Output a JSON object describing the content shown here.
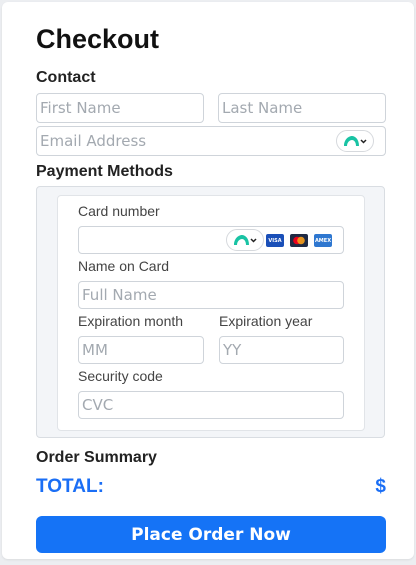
{
  "checkout": {
    "title": "Checkout",
    "contact": {
      "heading": "Contact",
      "first_name_placeholder": "First Name",
      "last_name_placeholder": "Last Name",
      "email_placeholder": "Email Address"
    },
    "payment": {
      "heading": "Payment Methods",
      "card_number_label": "Card number",
      "card_brands": [
        {
          "name": "VISA",
          "color": "#1a4fb8"
        },
        {
          "name": "Mastercard",
          "color": "#1f2a44"
        },
        {
          "name": "AMEX",
          "color": "#2e77d0"
        }
      ],
      "name_on_card_label": "Name on Card",
      "name_on_card_placeholder": "Full Name",
      "exp_month_label": "Expiration month",
      "exp_month_placeholder": "MM",
      "exp_year_label": "Expiration year",
      "exp_year_placeholder": "YY",
      "security_code_label": "Security code",
      "security_code_placeholder": "CVC"
    },
    "order_summary": {
      "heading": "Order Summary",
      "total_label": "TOTAL:",
      "total_value": "$"
    },
    "place_order_label": "Place Order Now",
    "colors": {
      "accent": "#1573f6",
      "autofill_icon": "#19c3a4"
    }
  }
}
